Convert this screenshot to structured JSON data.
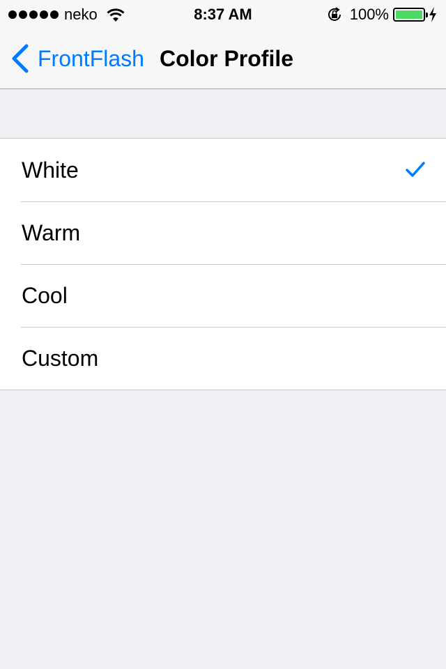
{
  "status_bar": {
    "carrier": "neko",
    "time": "8:37 AM",
    "battery_percent": "100%",
    "battery_level": 1.0,
    "battery_color": "#4cd964"
  },
  "nav": {
    "back_label": "FrontFlash",
    "title": "Color Profile",
    "tint": "#007aff"
  },
  "options": [
    {
      "label": "White",
      "selected": true
    },
    {
      "label": "Warm",
      "selected": false
    },
    {
      "label": "Cool",
      "selected": false
    },
    {
      "label": "Custom",
      "selected": false
    }
  ]
}
